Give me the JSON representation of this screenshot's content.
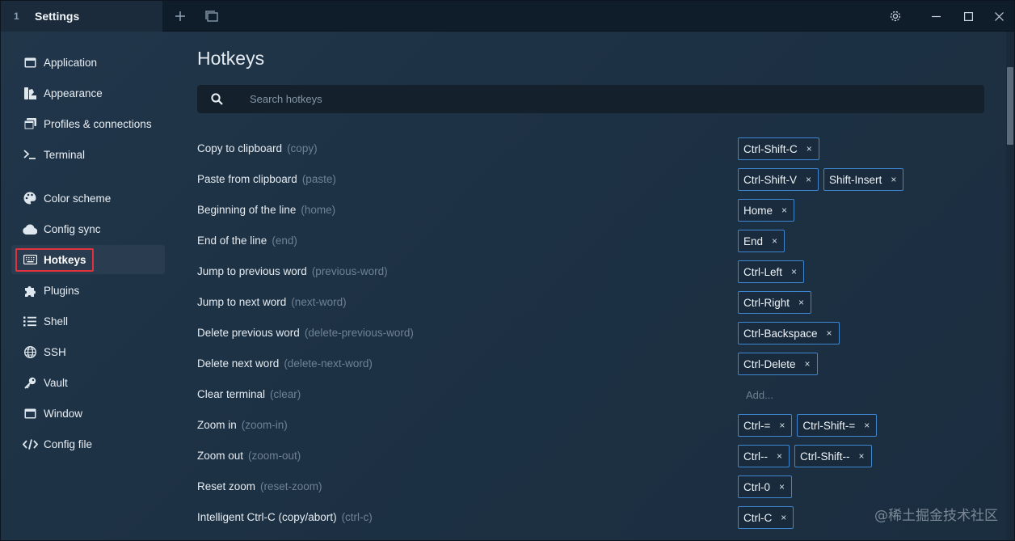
{
  "titlebar": {
    "tab_number": "1",
    "tab_title": "Settings"
  },
  "sidebar": {
    "items": [
      {
        "label": "Application",
        "icon": "window-icon"
      },
      {
        "label": "Appearance",
        "icon": "appearance-icon"
      },
      {
        "label": "Profiles & connections",
        "icon": "profiles-icon"
      },
      {
        "label": "Terminal",
        "icon": "terminal-icon"
      },
      {
        "label": "Color scheme",
        "icon": "palette-icon"
      },
      {
        "label": "Config sync",
        "icon": "cloud-icon"
      },
      {
        "label": "Hotkeys",
        "icon": "keyboard-icon",
        "active": true
      },
      {
        "label": "Plugins",
        "icon": "puzzle-icon"
      },
      {
        "label": "Shell",
        "icon": "list-icon"
      },
      {
        "label": "SSH",
        "icon": "globe-icon"
      },
      {
        "label": "Vault",
        "icon": "key-icon"
      },
      {
        "label": "Window",
        "icon": "window-icon"
      },
      {
        "label": "Config file",
        "icon": "code-icon"
      }
    ]
  },
  "main": {
    "title": "Hotkeys",
    "search_placeholder": "Search hotkeys",
    "add_label": "Add...",
    "hotkeys": [
      {
        "name": "Copy to clipboard",
        "id": "(copy)",
        "keys": [
          "Ctrl-Shift-C"
        ]
      },
      {
        "name": "Paste from clipboard",
        "id": "(paste)",
        "keys": [
          "Ctrl-Shift-V",
          "Shift-Insert"
        ]
      },
      {
        "name": "Beginning of the line",
        "id": "(home)",
        "keys": [
          "Home"
        ]
      },
      {
        "name": "End of the line",
        "id": "(end)",
        "keys": [
          "End"
        ]
      },
      {
        "name": "Jump to previous word",
        "id": "(previous-word)",
        "keys": [
          "Ctrl-Left"
        ]
      },
      {
        "name": "Jump to next word",
        "id": "(next-word)",
        "keys": [
          "Ctrl-Right"
        ]
      },
      {
        "name": "Delete previous word",
        "id": "(delete-previous-word)",
        "keys": [
          "Ctrl-Backspace"
        ]
      },
      {
        "name": "Delete next word",
        "id": "(delete-next-word)",
        "keys": [
          "Ctrl-Delete"
        ]
      },
      {
        "name": "Clear terminal",
        "id": "(clear)",
        "keys": []
      },
      {
        "name": "Zoom in",
        "id": "(zoom-in)",
        "keys": [
          "Ctrl-=",
          "Ctrl-Shift-="
        ]
      },
      {
        "name": "Zoom out",
        "id": "(zoom-out)",
        "keys": [
          "Ctrl--",
          "Ctrl-Shift--"
        ]
      },
      {
        "name": "Reset zoom",
        "id": "(reset-zoom)",
        "keys": [
          "Ctrl-0"
        ]
      },
      {
        "name": "Intelligent Ctrl-C (copy/abort)",
        "id": "(ctrl-c)",
        "keys": [
          "Ctrl-C"
        ]
      }
    ]
  },
  "chip_remove_glyph": "×",
  "watermark": "@稀土掘金技术社区",
  "colors": {
    "accent": "#3f86d0",
    "highlight_box": "#e0323c",
    "background": "#1f2f3f"
  }
}
